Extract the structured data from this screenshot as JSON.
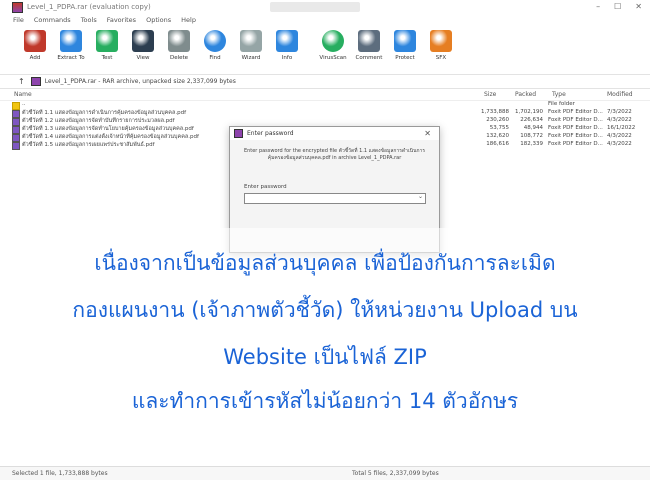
{
  "window": {
    "title": "Level_1_PDPA.rar (evaluation copy)",
    "controls": [
      "–",
      "☐",
      "✕"
    ]
  },
  "menu": [
    "File",
    "Commands",
    "Tools",
    "Favorites",
    "Options",
    "Help"
  ],
  "toolbar": [
    {
      "label": "Add",
      "icon": "add-archive-icon",
      "color": "#c0392b"
    },
    {
      "label": "Extract To",
      "icon": "extract-folder-icon",
      "color": "#2e86de"
    },
    {
      "label": "Test",
      "icon": "test-icon",
      "color": "#27ae60"
    },
    {
      "label": "View",
      "icon": "view-icon",
      "color": "#2c3e50"
    },
    {
      "label": "Delete",
      "icon": "delete-icon",
      "color": "#7f8c8d"
    },
    {
      "label": "Find",
      "icon": "find-icon",
      "color": "#2e86de"
    },
    {
      "label": "Wizard",
      "icon": "wizard-icon",
      "color": "#95a5a6"
    },
    {
      "label": "Info",
      "icon": "info-icon",
      "color": "#2e86de"
    },
    {
      "label": "VirusScan",
      "icon": "virusscan-icon",
      "color": "#27ae60"
    },
    {
      "label": "Comment",
      "icon": "comment-icon",
      "color": "#5d6d7e"
    },
    {
      "label": "Protect",
      "icon": "protect-icon",
      "color": "#2e86de"
    },
    {
      "label": "SFX",
      "icon": "sfx-icon",
      "color": "#e67e22"
    }
  ],
  "address": {
    "text": "Level_1_PDPA.rar - RAR archive, unpacked size 2,337,099 bytes"
  },
  "columns": {
    "name": "Name",
    "size": "Size",
    "packed": "Packed",
    "type": "Type",
    "modified": "Modified"
  },
  "files": [
    {
      "name": "..",
      "size": "",
      "packed": "",
      "type": "File folder",
      "modified": "",
      "folder": true
    },
    {
      "name": "ตัวชี้วัดที่ 1.1 แสดงข้อมูลการดำเนินการคุ้มครองข้อมูลส่วนบุคคล.pdf",
      "size": "1,733,888",
      "packed": "1,702,190",
      "type": "Foxit PDF Editor D...",
      "modified": "7/3/2022"
    },
    {
      "name": "ตัวชี้วัดที่ 1.2 แสดงข้อมูลการจัดทำบันทึกรายการประมวลผล.pdf",
      "size": "230,260",
      "packed": "226,634",
      "type": "Foxit PDF Editor D...",
      "modified": "4/3/2022"
    },
    {
      "name": "ตัวชี้วัดที่ 1.3 แสดงข้อมูลการจัดทำนโยบายคุ้มครองข้อมูลส่วนบุคคล.pdf",
      "size": "53,755",
      "packed": "48,944",
      "type": "Foxit PDF Editor D...",
      "modified": "16/1/2022"
    },
    {
      "name": "ตัวชี้วัดที่ 1.4 แสดงข้อมูลการแต่งตั้งเจ้าหน้าที่คุ้มครองข้อมูลส่วนบุคคล.pdf",
      "size": "132,620",
      "packed": "108,772",
      "type": "Foxit PDF Editor D...",
      "modified": "4/3/2022"
    },
    {
      "name": "ตัวชี้วัดที่ 1.5 แสดงข้อมูลการเผยแพร่ประชาสัมพันธ์.pdf",
      "size": "186,616",
      "packed": "182,339",
      "type": "Foxit PDF Editor D...",
      "modified": "4/3/2022"
    }
  ],
  "dialog": {
    "title": "Enter password",
    "message": "Enter password for the encrypted file ตัวชี้วัดที่ 1.1 แสดงข้อมูลการดำเนินการคุ้มครองข้อมูลส่วนบุคคล.pdf in archive Level_1_PDPA.rar",
    "label": "Enter password",
    "value": ""
  },
  "overlay": {
    "line1": "เนื่องจากเป็นข้อมูลส่วนบุคคล เพื่อป้องกันการละเมิด",
    "line2": "กองแผนงาน (เจ้าภาพตัวชี้วัด) ให้หน่วยงาน Upload บน",
    "line3": "Website เป็นไฟล์ ZIP",
    "line4": "และทำการเข้ารหัสไม่น้อยกว่า 14 ตัวอักษร",
    "color": "#1a63d6"
  },
  "status": {
    "left": "Selected 1 file, 1,733,888 bytes",
    "right": "Total 5 files, 2,337,099 bytes"
  }
}
